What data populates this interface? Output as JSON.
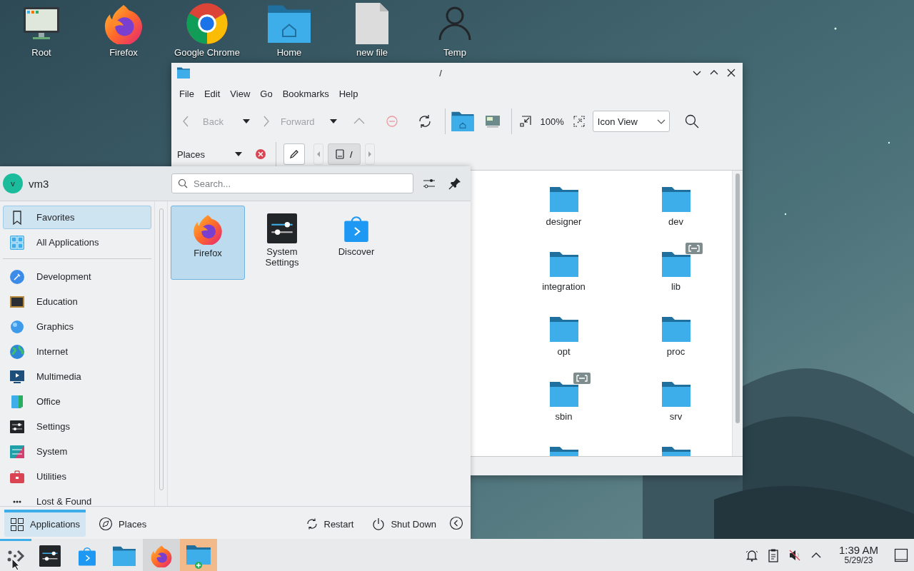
{
  "desktop_icons": [
    {
      "label": "Root",
      "kind": "computer"
    },
    {
      "label": "Firefox",
      "kind": "firefox"
    },
    {
      "label": "Google Chrome",
      "kind": "chrome"
    },
    {
      "label": "Home",
      "kind": "home-folder"
    },
    {
      "label": "new file",
      "kind": "file"
    },
    {
      "label": "Temp",
      "kind": "user"
    }
  ],
  "window": {
    "title": "/",
    "menu": [
      "File",
      "Edit",
      "View",
      "Go",
      "Bookmarks",
      "Help"
    ],
    "toolbar": {
      "back": {
        "label": "Back",
        "disabled": true
      },
      "forward": {
        "label": "Forward",
        "disabled": true
      },
      "zoom": "100%",
      "view_mode": "Icon View"
    },
    "places_panel": {
      "label": "Places"
    },
    "breadcrumb": {
      "segment": "/"
    },
    "files": [
      {
        "name": "designer",
        "symlink": false
      },
      {
        "name": "dev",
        "symlink": false
      },
      {
        "name": "integration",
        "symlink": false
      },
      {
        "name": "lib",
        "symlink": true
      },
      {
        "name": "opt",
        "symlink": false
      },
      {
        "name": "proc",
        "symlink": false
      },
      {
        "name": "sbin",
        "symlink": true
      },
      {
        "name": "srv",
        "symlink": false
      },
      {
        "symlink": false
      },
      {
        "symlink": false
      }
    ]
  },
  "launcher": {
    "user": {
      "initial": "v",
      "name": "vm3"
    },
    "search": {
      "placeholder": "Search..."
    },
    "categories": [
      {
        "label": "Favorites",
        "kind": "favorites",
        "selected": true
      },
      {
        "label": "All Applications",
        "kind": "all",
        "selected": false
      },
      {
        "label": "Development",
        "kind": "development",
        "selected": false
      },
      {
        "label": "Education",
        "kind": "education",
        "selected": false
      },
      {
        "label": "Graphics",
        "kind": "graphics",
        "selected": false
      },
      {
        "label": "Internet",
        "kind": "internet",
        "selected": false
      },
      {
        "label": "Multimedia",
        "kind": "multimedia",
        "selected": false
      },
      {
        "label": "Office",
        "kind": "office",
        "selected": false
      },
      {
        "label": "Settings",
        "kind": "settings",
        "selected": false
      },
      {
        "label": "System",
        "kind": "system",
        "selected": false
      },
      {
        "label": "Utilities",
        "kind": "utilities",
        "selected": false
      },
      {
        "label": "Lost & Found",
        "kind": "lost",
        "selected": false
      }
    ],
    "apps": [
      {
        "label": "Firefox",
        "kind": "firefox",
        "selected": true
      },
      {
        "label": "System Settings",
        "kind": "settings",
        "selected": false
      },
      {
        "label": "Discover",
        "kind": "discover",
        "selected": false
      }
    ],
    "tabs": [
      {
        "label": "Applications",
        "kind": "grid",
        "selected": true
      },
      {
        "label": "Places",
        "kind": "compass",
        "selected": false
      }
    ],
    "actions": [
      {
        "label": "Restart",
        "kind": "restart"
      },
      {
        "label": "Shut Down",
        "kind": "shutdown"
      }
    ]
  },
  "taskbar": {
    "tasks": [
      {
        "kind": "launcher",
        "active": true,
        "hovered": false,
        "attention": false
      },
      {
        "kind": "settings",
        "active": false,
        "hovered": false,
        "attention": false
      },
      {
        "kind": "discover",
        "active": false,
        "hovered": false,
        "attention": false
      },
      {
        "kind": "folder",
        "active": false,
        "hovered": false,
        "attention": false
      },
      {
        "kind": "firefox",
        "active": false,
        "hovered": true,
        "attention": false
      },
      {
        "kind": "folder-new",
        "active": false,
        "hovered": false,
        "attention": true
      }
    ],
    "tray": [
      {
        "kind": "notifications"
      },
      {
        "kind": "clipboard"
      },
      {
        "kind": "volume-muted"
      },
      {
        "kind": "expand"
      }
    ],
    "clock": {
      "time": "1:39 AM",
      "date": "5/29/23"
    }
  }
}
